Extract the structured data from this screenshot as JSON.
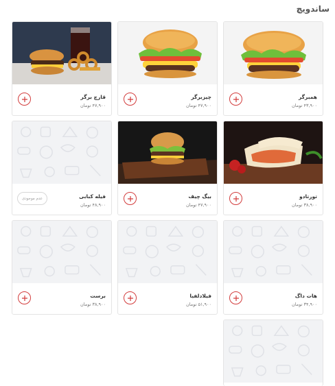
{
  "section": {
    "title": "ساندویچ"
  },
  "currency_note": "",
  "products": [
    {
      "name": "همبرگر",
      "price": "۴۳,۹۰۰ تومان",
      "image": "burger",
      "available": true
    },
    {
      "name": "چیزبرگر",
      "price": "۴۷,۹۰۰ تومان",
      "image": "burger",
      "available": true
    },
    {
      "name": "قارچ برگر",
      "price": "۴۷,۹۰۰ تومان",
      "image": "burger-meal",
      "available": true
    },
    {
      "name": "تورتادو",
      "price": "۳۸,۹۰۰ تومان",
      "image": "wrap",
      "available": true
    },
    {
      "name": "بیگ چیف",
      "price": "۴۷,۹۰۰ تومان",
      "image": "burger-board",
      "available": true
    },
    {
      "name": "فیله کبابی",
      "price": "۴۸,۹۰۰ تومان",
      "image": "placeholder",
      "available": false,
      "unavailable_label": "عدم موجودی"
    },
    {
      "name": "هات داگ",
      "price": "۳۴,۹۰۰ تومان",
      "image": "placeholder",
      "available": true
    },
    {
      "name": "فیلادلفیا",
      "price": "۵۱,۹۰۰ تومان",
      "image": "placeholder",
      "available": true
    },
    {
      "name": "برست",
      "price": "۳۸,۹۰۰ تومان",
      "image": "placeholder",
      "available": true
    },
    {
      "name": "",
      "price": "",
      "image": "placeholder",
      "available": true
    }
  ],
  "icons": {
    "add": "plus-circle-icon"
  },
  "colors": {
    "accent": "#d23b3b"
  }
}
